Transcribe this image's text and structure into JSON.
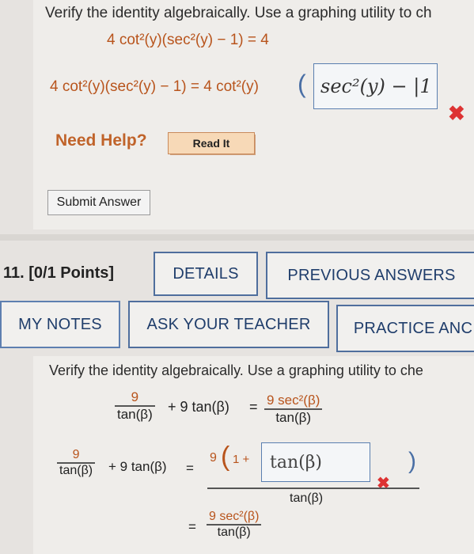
{
  "prev_question": {
    "instruction": "Verify the identity algebraically. Use a graphing utility to ch",
    "identity": "4 cot²(y)(sec²(y) − 1) = 4",
    "step_left": "4 cot²(y)(sec²(y) − 1) = 4 cot²(y)",
    "open_paren": "(",
    "answer_value": "sec²(y) − |1",
    "answer_status": "incorrect",
    "need_help": "Need Help?",
    "read_it": "Read It",
    "submit": "Submit Answer"
  },
  "question": {
    "number_points": "11.  [0/1 Points]",
    "buttons": {
      "details": "DETAILS",
      "previous_answers": "PREVIOUS ANSWERS",
      "my_notes": "MY NOTES",
      "ask_teacher": "ASK YOUR TEACHER",
      "practice": "PRACTICE ANC"
    },
    "instruction": "Verify the identity algebraically. Use a graphing utility to che",
    "identity": {
      "frac1_num": "9",
      "frac1_den": "tan(β)",
      "plus_term": "+ 9 tan(β)",
      "equals": "=",
      "frac2_num": "9 sec²(β)",
      "frac2_den": "tan(β)"
    },
    "step1": {
      "frac1_num": "9",
      "frac1_den": "tan(β)",
      "plus_term": "+ 9 tan(β)",
      "equals": "=",
      "num_prefix": "9",
      "open_paren": "(",
      "one_plus": "1 +",
      "answer_value": "tan(β)",
      "close_paren": ")",
      "den": "tan(β)",
      "answer_status": "incorrect"
    },
    "step2": {
      "equals": "=",
      "num": "9 sec²(β)",
      "den": "tan(β)"
    }
  }
}
